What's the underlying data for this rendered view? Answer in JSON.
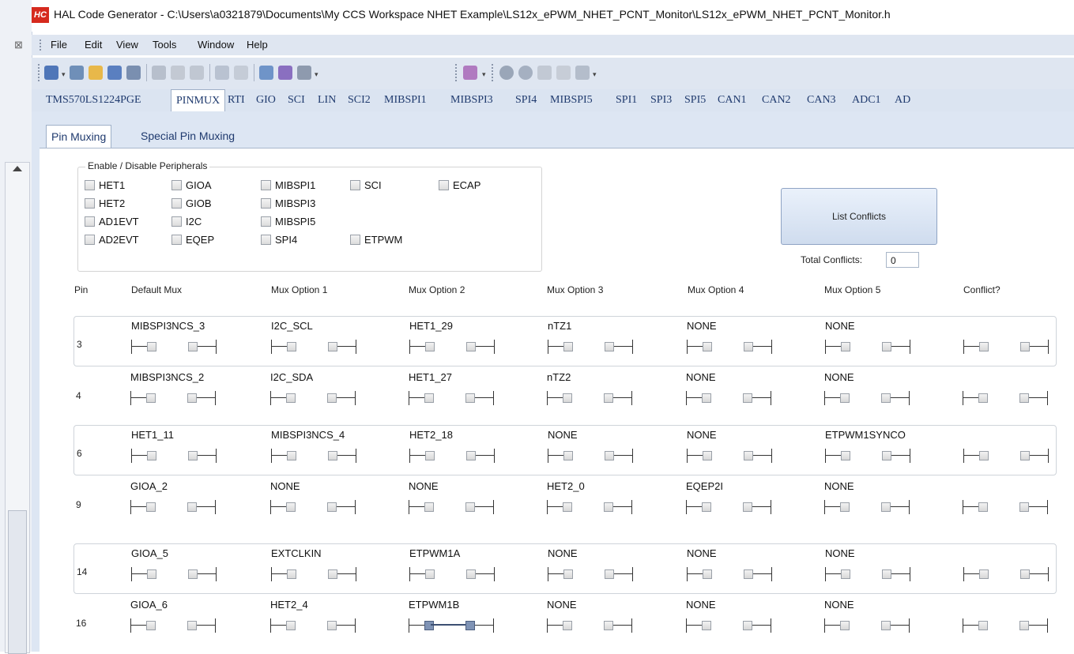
{
  "window": {
    "title": "HAL Code Generator - C:\\Users\\a0321879\\Documents\\My CCS Workspace NHET Example\\LS12x_ePWM_NHET_PCNT_Monitor\\LS12x_ePWM_NHET_PCNT_Monitor.h",
    "app_icon": "HC"
  },
  "left_gutter": {
    "close_glyph": "⊠"
  },
  "menu": [
    "File",
    "Edit",
    "View",
    "Tools",
    "Window",
    "Help"
  ],
  "toolbar": {
    "icons": [
      "new-project-icon",
      "open-icon",
      "folder-icon",
      "save-icon",
      "save-all-icon",
      "cut-icon",
      "copy-icon",
      "paste-icon",
      "undo-icon",
      "redo-icon",
      "find-icon",
      "replace-icon",
      "list-icon",
      "generate-icon",
      "nav-back-icon",
      "nav-forward-icon",
      "export-icon",
      "import-icon",
      "home-icon"
    ]
  },
  "tabs": [
    "TMS570LS1224PGE",
    "PINMUX",
    "RTI",
    "GIO",
    "SCI",
    "LIN",
    "SCI2",
    "MIBSPI1",
    "MIBSPI3",
    "SPI4",
    "MIBSPI5",
    "SPI1",
    "SPI3",
    "SPI5",
    "CAN1",
    "CAN2",
    "CAN3",
    "ADC1",
    "AD"
  ],
  "active_tab": "PINMUX",
  "subtabs": [
    "Pin Muxing",
    "Special Pin Muxing"
  ],
  "peripherals": {
    "title": "Enable / Disable Peripherals",
    "items": [
      "HET1",
      "GIOA",
      "MIBSPI1",
      "SCI",
      "ECAP",
      "HET2",
      "GIOB",
      "MIBSPI3",
      "AD1EVT",
      "I2C",
      "MIBSPI5",
      "AD2EVT",
      "EQEP",
      "SPI4",
      "ETPWM"
    ]
  },
  "conflicts": {
    "button": "List Conflicts",
    "label": "Total Conflicts:",
    "value": "0"
  },
  "columns": [
    "Pin",
    "Default Mux",
    "Mux Option 1",
    "Mux Option 2",
    "Mux Option 3",
    "Mux Option 4",
    "Mux Option 5",
    "Conflict?"
  ],
  "rows": [
    {
      "pin": "3",
      "options": [
        "MIBSPI3NCS_3",
        "I2C_SCL",
        "HET1_29",
        "nTZ1",
        "NONE",
        "NONE"
      ],
      "bordered": true,
      "active": -1
    },
    {
      "pin": "4",
      "options": [
        "MIBSPI3NCS_2",
        "I2C_SDA",
        "HET1_27",
        "nTZ2",
        "NONE",
        "NONE"
      ],
      "bordered": false,
      "active": -1
    },
    {
      "pin": "6",
      "options": [
        "HET1_11",
        "MIBSPI3NCS_4",
        "HET2_18",
        "NONE",
        "NONE",
        "ETPWM1SYNCO"
      ],
      "bordered": true,
      "active": -1
    },
    {
      "pin": "9",
      "options": [
        "GIOA_2",
        "NONE",
        "NONE",
        "HET2_0",
        "EQEP2I",
        "NONE"
      ],
      "bordered": false,
      "active": -1
    },
    {
      "pin": "14",
      "options": [
        "GIOA_5",
        "EXTCLKIN",
        "ETPWM1A",
        "NONE",
        "NONE",
        "NONE"
      ],
      "bordered": true,
      "active": -1
    },
    {
      "pin": "16",
      "options": [
        "GIOA_6",
        "HET2_4",
        "ETPWM1B",
        "NONE",
        "NONE",
        "NONE"
      ],
      "bordered": false,
      "active": 2
    }
  ],
  "colors": {
    "accent": "#1f3a6e",
    "chrome": "#dfe6f1",
    "tabstrip": "#dbe4f1",
    "button_top": "#eaf1fb",
    "button_bottom": "#cfdcee"
  }
}
